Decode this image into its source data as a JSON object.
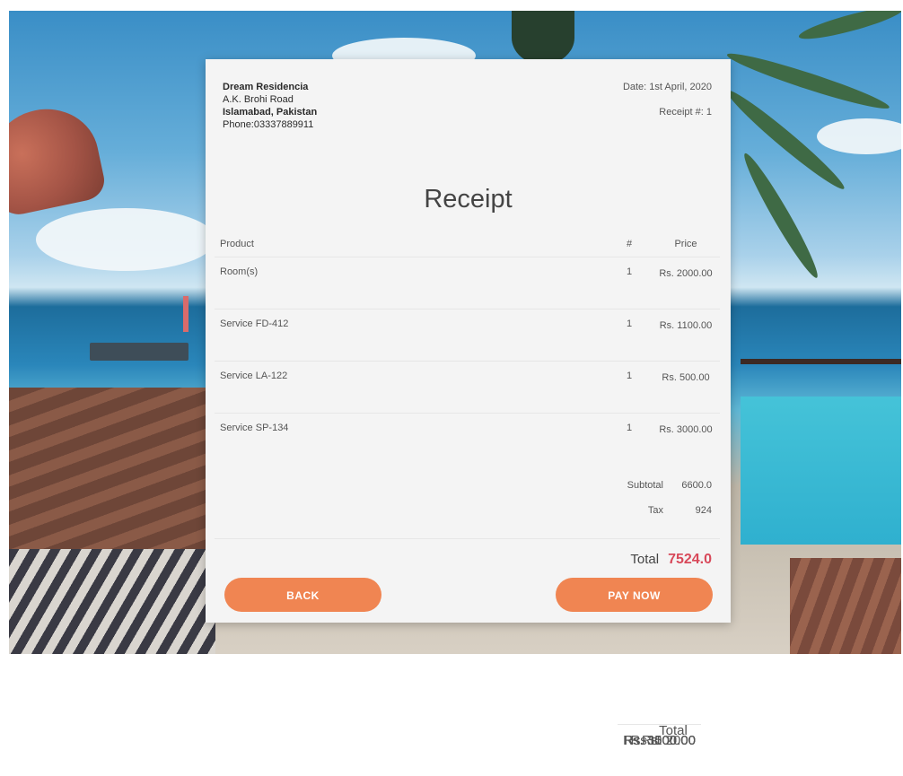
{
  "company": {
    "name": "Dream Residencia",
    "address_line1": "A.K. Brohi Road",
    "address_line2": "Islamabad, Pakistan",
    "phone": "Phone:03337889911"
  },
  "meta": {
    "date": "Date: 1st April, 2020",
    "receipt_number": "Receipt #: 1"
  },
  "title": "Receipt",
  "table": {
    "headers": {
      "product": "Product",
      "qty": "#",
      "price": "Price",
      "total": "Total"
    },
    "rows": [
      {
        "product": "Room(s)",
        "qty": "1",
        "price": "Rs. 2000.00",
        "total": "Rs. 2000"
      },
      {
        "product": "Service FD-412",
        "qty": "1",
        "price": "Rs. 1100.00",
        "total": "Rs. 1100.00"
      },
      {
        "product": "Service LA-122",
        "qty": "1",
        "price": "Rs. 500.00",
        "total": "Rs. 500.00"
      },
      {
        "product": "Service SP-134",
        "qty": "1",
        "price": "Rs. 3000.00",
        "total": "Rs. 3000.00"
      }
    ]
  },
  "summary": {
    "subtotal_label": "Subtotal",
    "subtotal_value": "6600.0",
    "tax_label": "Tax",
    "tax_value": "924",
    "total_label": "Total",
    "total_value": "7524.0"
  },
  "buttons": {
    "back": "BACK",
    "pay": "PAY NOW"
  },
  "colors": {
    "accent_button": "#f08552",
    "total_value": "#d8495a",
    "card_background": "#f4f4f4"
  }
}
